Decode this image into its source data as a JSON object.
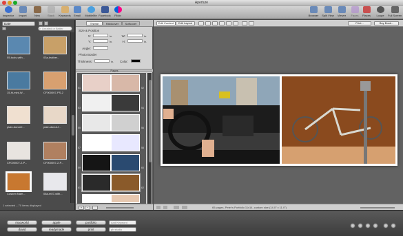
{
  "window": {
    "title": "Aperture"
  },
  "toolbar": {
    "left": [
      {
        "label": "Inspector",
        "icon": "inspector-icon",
        "color": "#3a6fd0"
      },
      {
        "label": "Import",
        "icon": "import-icon",
        "color": "#6a8ab8"
      },
      {
        "label": "New",
        "icon": "new-icon",
        "color": "#8a6a4a"
      },
      {
        "label": "Stack",
        "icon": "stack-icon",
        "color": "#a8a8a8"
      },
      {
        "label": "Keywords",
        "icon": "keywords-icon",
        "color": "#d8b070"
      },
      {
        "label": "Email",
        "icon": "email-icon",
        "color": "#5a88c8"
      },
      {
        "label": "MobileMe",
        "icon": "mobileme-icon",
        "color": "#4aa0e0"
      },
      {
        "label": "Facebook",
        "icon": "facebook-icon",
        "color": "#3b5998"
      },
      {
        "label": "Flickr",
        "icon": "flickr-icon",
        "color": "#e0408a"
      }
    ],
    "right": [
      {
        "label": "Browser",
        "icon": "browser-icon",
        "color": "#6a8ab8"
      },
      {
        "label": "Split View",
        "icon": "split-view-icon",
        "color": "#6a8ab8"
      },
      {
        "label": "Viewer",
        "icon": "viewer-icon",
        "color": "#6a8ab8"
      },
      {
        "label": "Faces",
        "icon": "faces-icon",
        "color": "#b08ad0"
      },
      {
        "label": "Places",
        "icon": "places-icon",
        "color": "#c85050"
      },
      {
        "label": "Loupe",
        "icon": "loupe-icon",
        "color": "#555555"
      },
      {
        "label": "Full Screen",
        "icon": "full-screen-icon",
        "color": "#666666"
      }
    ]
  },
  "browser": {
    "project_select": "Date",
    "search_placeholder": "Unrated or Better",
    "status": "1 selected – 70 items displayed",
    "thumbs": [
      {
        "caption": "05-tools-with...",
        "color": "#5a88b0"
      },
      {
        "caption": "03a-leather...",
        "color": "#c8a068"
      },
      {
        "caption": "15-hi-mini-W...",
        "color": "#4a7aa0"
      },
      {
        "caption": "CF000007-PS-2",
        "color": "#d8a070"
      },
      {
        "caption": "plain-donut-f...",
        "color": "#f0e0d0"
      },
      {
        "caption": "plain-donut-f...",
        "color": "#e8d8c8"
      },
      {
        "caption": "CF000007-2-P...",
        "color": "#e8e4e0"
      },
      {
        "caption": "CF000007-2-P...",
        "color": "#b08060"
      },
      {
        "caption": "Custom Nam...",
        "color": "#c87830"
      },
      {
        "caption": "06a-m07-with...",
        "color": "#e8e8ec"
      }
    ]
  },
  "inspector": {
    "tabs": [
      "Theme",
      "Hardcover",
      "Softcover"
    ],
    "size_position": "Size & Position",
    "x_label": "X:",
    "y_label": "Y:",
    "w_label": "W:",
    "h_label": "H:",
    "unit": "in.",
    "angle_label": "Angle:",
    "photo_border": "Photo Border",
    "thickness_label": "Thickness:",
    "color_label": "Color:",
    "pages_header": "Pages",
    "page_numbers": [
      "51",
      "52",
      "53",
      "54",
      "55",
      "56",
      "57",
      "58",
      "59",
      "60",
      "61",
      "62",
      "63"
    ],
    "spreads": [
      {
        "left": "#e8d0c8",
        "right": "#d8b8a8"
      },
      {
        "left": "#f0f0f0",
        "right": "#3a3a3a"
      },
      {
        "left": "#e8e8e8",
        "right": "#d0d0d0"
      },
      {
        "left": "#ffffff",
        "right": "#e8e8ff"
      },
      {
        "left": "#151515",
        "right": "#2a4a70"
      },
      {
        "left": "#2a2a2a",
        "right": "#8a5a2a"
      },
      {
        "left": "#ffffff",
        "right": "#e6c8b0"
      }
    ]
  },
  "main_toolbar": {
    "edit_content": "Edit Content",
    "edit_layout": "Edit Layout",
    "print": "Print...",
    "buy_book": "Buy Book..."
  },
  "footer": {
    "info": "65 pages, Peter's Portfolio 11x14, custom size (14.0\" x 11.0\")"
  },
  "keywords": {
    "buttons": [
      "macworld",
      "apple",
      "portfolio",
      "david",
      "readymade",
      "print"
    ],
    "add_placeholder": "Add Keyword",
    "preset": "pb studio"
  }
}
